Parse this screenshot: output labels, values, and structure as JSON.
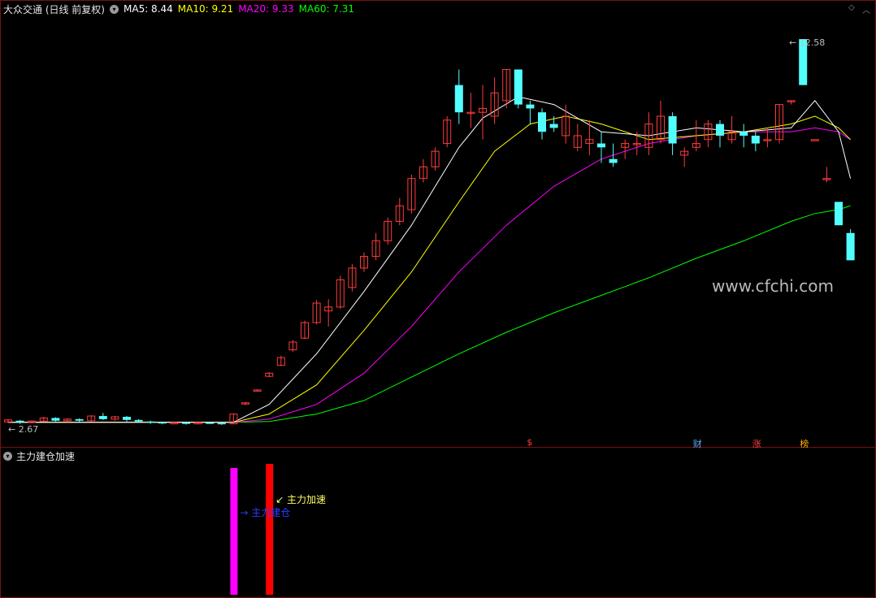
{
  "header": {
    "title": "大众交通 (日线 前复权)",
    "ma5": "MA5: 8.44",
    "ma10": "MA10: 9.21",
    "ma20": "MA20: 9.33",
    "ma60": "MA60: 7.31"
  },
  "corner_icons": [
    "diamond-icon",
    "chevron-icon"
  ],
  "colors": {
    "up": "#ff3b3b",
    "down": "#52ffff",
    "ma5": "#ffffff",
    "ma10": "#ffff00",
    "ma20": "#ff00ff",
    "ma60": "#00ff00",
    "frame": "#7a1010"
  },
  "watermark": "www.cfchi.com",
  "markers": [
    {
      "text": "$",
      "color": "#ff3b3b",
      "bar": 44
    },
    {
      "text": "财",
      "color": "#5aa8ff",
      "bar": 58
    },
    {
      "text": "涨",
      "color": "#ff4040",
      "bar": 63
    },
    {
      "text": "榜",
      "color": "#ffb000",
      "bar": 67
    }
  ],
  "subchart": {
    "title": "主力建仓加速",
    "signals": [
      {
        "name": "主力建仓",
        "bar": 19,
        "color": "#ff00ff",
        "label_color": "#2a3bff"
      },
      {
        "name": "主力加速",
        "bar": 22,
        "color": "#ff0000",
        "label_color": "#ffff66"
      }
    ]
  },
  "chart_data": {
    "type": "candlestick",
    "price_low_label": "2.67",
    "price_high_label": "12.58",
    "ylim": [
      2.4,
      13.0
    ],
    "candles": [
      [
        2.75,
        2.8,
        2.72,
        2.82
      ],
      [
        2.78,
        2.74,
        2.7,
        2.8
      ],
      [
        2.74,
        2.77,
        2.71,
        2.79
      ],
      [
        2.77,
        2.85,
        2.75,
        2.88
      ],
      [
        2.85,
        2.78,
        2.76,
        2.87
      ],
      [
        2.78,
        2.82,
        2.74,
        2.84
      ],
      [
        2.82,
        2.78,
        2.75,
        2.84
      ],
      [
        2.78,
        2.9,
        2.76,
        2.92
      ],
      [
        2.9,
        2.82,
        2.8,
        2.98
      ],
      [
        2.82,
        2.88,
        2.78,
        2.9
      ],
      [
        2.88,
        2.8,
        2.76,
        2.9
      ],
      [
        2.8,
        2.76,
        2.72,
        2.82
      ],
      [
        2.76,
        2.74,
        2.7,
        2.78
      ],
      [
        2.74,
        2.72,
        2.69,
        2.76
      ],
      [
        2.72,
        2.73,
        2.7,
        2.75
      ],
      [
        2.73,
        2.71,
        2.68,
        2.74
      ],
      [
        2.71,
        2.73,
        2.69,
        2.74
      ],
      [
        2.73,
        2.72,
        2.7,
        2.74
      ],
      [
        2.72,
        2.7,
        2.67,
        2.73
      ],
      [
        2.7,
        2.95,
        2.69,
        2.97
      ],
      [
        3.22,
        3.24,
        3.18,
        3.26
      ],
      [
        3.55,
        3.57,
        3.53,
        3.59
      ],
      [
        3.92,
        4.0,
        3.9,
        4.03
      ],
      [
        4.2,
        4.4,
        4.18,
        4.45
      ],
      [
        4.6,
        4.8,
        4.55,
        4.85
      ],
      [
        4.9,
        5.3,
        4.88,
        5.35
      ],
      [
        5.3,
        5.8,
        5.25,
        5.88
      ],
      [
        5.6,
        5.7,
        5.2,
        5.9
      ],
      [
        5.7,
        6.4,
        5.65,
        6.5
      ],
      [
        6.2,
        6.7,
        6.1,
        6.8
      ],
      [
        6.7,
        7.0,
        6.6,
        7.1
      ],
      [
        7.0,
        7.4,
        6.9,
        7.6
      ],
      [
        7.4,
        7.9,
        7.3,
        8.0
      ],
      [
        7.9,
        8.3,
        7.8,
        8.5
      ],
      [
        8.2,
        9.0,
        8.1,
        9.1
      ],
      [
        9.0,
        9.3,
        8.9,
        9.5
      ],
      [
        9.3,
        9.7,
        9.2,
        9.8
      ],
      [
        9.9,
        10.5,
        9.8,
        10.6
      ],
      [
        11.4,
        10.7,
        10.4,
        11.8
      ],
      [
        10.7,
        10.7,
        10.3,
        11.2
      ],
      [
        10.7,
        10.8,
        10.0,
        11.4
      ],
      [
        10.6,
        11.2,
        10.4,
        11.6
      ],
      [
        11.0,
        11.8,
        10.8,
        11.8
      ],
      [
        11.8,
        10.9,
        10.8,
        11.8
      ],
      [
        10.9,
        10.8,
        10.4,
        11.0
      ],
      [
        10.7,
        10.2,
        10.0,
        10.8
      ],
      [
        10.4,
        10.3,
        10.2,
        10.6
      ],
      [
        10.1,
        10.6,
        9.9,
        10.9
      ],
      [
        9.8,
        10.1,
        9.7,
        10.4
      ],
      [
        9.9,
        10.0,
        9.6,
        10.5
      ],
      [
        9.9,
        9.8,
        9.4,
        10.2
      ],
      [
        9.5,
        9.4,
        9.3,
        9.9
      ],
      [
        9.8,
        9.9,
        9.5,
        10.0
      ],
      [
        9.9,
        9.9,
        9.6,
        10.2
      ],
      [
        9.8,
        10.4,
        9.6,
        10.7
      ],
      [
        10.0,
        10.6,
        9.9,
        11.0
      ],
      [
        10.6,
        9.9,
        9.6,
        10.7
      ],
      [
        9.6,
        9.7,
        9.3,
        9.8
      ],
      [
        9.8,
        9.9,
        9.7,
        10.5
      ],
      [
        10.0,
        10.4,
        9.8,
        10.5
      ],
      [
        10.4,
        10.1,
        9.8,
        10.5
      ],
      [
        10.0,
        10.2,
        9.9,
        10.6
      ],
      [
        10.2,
        10.1,
        9.8,
        10.4
      ],
      [
        10.1,
        9.9,
        9.7,
        10.2
      ],
      [
        10.0,
        10.0,
        9.8,
        10.3
      ],
      [
        10.0,
        10.9,
        9.9,
        10.9
      ],
      [
        11.0,
        11.0,
        10.9,
        11.0
      ],
      [
        12.58,
        11.4,
        11.4,
        12.58
      ],
      [
        10.0,
        10.0,
        10.0,
        10.0
      ],
      [
        9.0,
        9.0,
        8.9,
        9.3
      ],
      [
        8.4,
        7.8,
        7.8,
        8.4
      ],
      [
        7.6,
        6.9,
        6.9,
        7.7
      ]
    ],
    "ma5": [
      [
        0,
        2.74
      ],
      [
        19,
        2.74
      ],
      [
        22,
        3.2
      ],
      [
        26,
        4.5
      ],
      [
        30,
        6.1
      ],
      [
        34,
        7.8
      ],
      [
        38,
        9.8
      ],
      [
        40,
        10.55
      ],
      [
        43,
        11.1
      ],
      [
        46,
        10.9
      ],
      [
        50,
        10.2
      ],
      [
        54,
        10.1
      ],
      [
        58,
        10.3
      ],
      [
        62,
        10.2
      ],
      [
        66,
        10.3
      ],
      [
        68,
        11.0
      ],
      [
        70,
        10.2
      ],
      [
        71,
        9.0
      ]
    ],
    "ma10": [
      [
        0,
        2.74
      ],
      [
        19,
        2.74
      ],
      [
        22,
        2.95
      ],
      [
        26,
        3.7
      ],
      [
        30,
        5.1
      ],
      [
        34,
        6.6
      ],
      [
        38,
        8.4
      ],
      [
        41,
        9.7
      ],
      [
        44,
        10.4
      ],
      [
        47,
        10.6
      ],
      [
        50,
        10.4
      ],
      [
        54,
        10.0
      ],
      [
        58,
        10.1
      ],
      [
        62,
        10.2
      ],
      [
        66,
        10.4
      ],
      [
        68,
        10.6
      ],
      [
        70,
        10.3
      ],
      [
        71,
        10.0
      ]
    ],
    "ma20": [
      [
        0,
        2.74
      ],
      [
        19,
        2.74
      ],
      [
        22,
        2.82
      ],
      [
        26,
        3.2
      ],
      [
        30,
        4.0
      ],
      [
        34,
        5.2
      ],
      [
        38,
        6.6
      ],
      [
        42,
        7.8
      ],
      [
        46,
        8.8
      ],
      [
        50,
        9.5
      ],
      [
        54,
        9.9
      ],
      [
        58,
        10.1
      ],
      [
        62,
        10.2
      ],
      [
        66,
        10.2
      ],
      [
        68,
        10.3
      ],
      [
        70,
        10.2
      ],
      [
        71,
        10.0
      ]
    ],
    "ma60": [
      [
        0,
        2.74
      ],
      [
        19,
        2.74
      ],
      [
        22,
        2.76
      ],
      [
        26,
        2.95
      ],
      [
        30,
        3.3
      ],
      [
        34,
        3.9
      ],
      [
        38,
        4.5
      ],
      [
        42,
        5.05
      ],
      [
        46,
        5.55
      ],
      [
        50,
        6.0
      ],
      [
        54,
        6.45
      ],
      [
        58,
        6.95
      ],
      [
        62,
        7.4
      ],
      [
        66,
        7.9
      ],
      [
        68,
        8.1
      ],
      [
        70,
        8.2
      ],
      [
        71,
        8.3
      ]
    ]
  }
}
